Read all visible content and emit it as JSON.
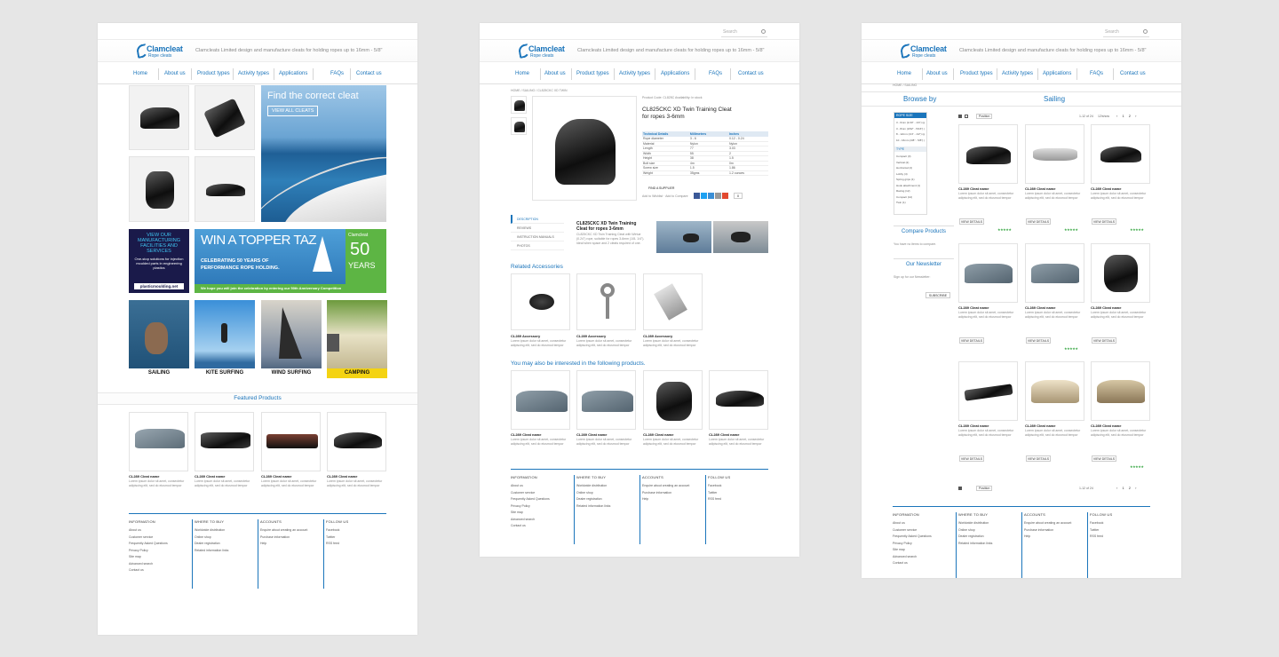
{
  "brand": {
    "logo": "Clamcleat",
    "logo_sub": "Rope cleats",
    "tagline": "Clamcleats Limited design and manufacture cleats for holding ropes up to 16mm - 5/8\""
  },
  "search": {
    "placeholder": "Search"
  },
  "nav": [
    "Home",
    "About us",
    "Product types",
    "Activity types",
    "Applications",
    "FAQs",
    "Contact us"
  ],
  "home": {
    "hero_title": "Find the correct cleat",
    "hero_button": "VIEW ALL CLEATS",
    "promo_lines": [
      "VIEW OUR",
      "MANUFACTURING",
      "FACILITIES AND",
      "SERVICES"
    ],
    "promo_sub": "One-stop solutions for injection moulded parts in engineering plastics",
    "promo_url": "plasticmoulding.net",
    "banner_title": "WIN A TOPPER TAZ",
    "banner_sub1": "CELEBRATING 50 YEARS OF",
    "banner_sub2": "PERFORMANCE ROPE HOLDING.",
    "banner_brand": "Clamcleat",
    "banner_years_num": "50",
    "banner_years": "YEARS",
    "banner_footer": "We hope you will join the celebration by entering our 50th Anniversary Competition",
    "activities": [
      "SAILING",
      "KITE SURFING",
      "WIND SURFING",
      "CAMPING"
    ],
    "featured_title": "Featured Products"
  },
  "products": {
    "name": "CL289 Cleat name",
    "desc": "Lorem ipsum dolor sit amet, consectetur adipiscing elit, sed do eiusmod tempor",
    "accessory_name": "CL289 Accessory"
  },
  "product_page": {
    "breadcrumb": "HOME / SAILING / CL825CKC XD TWIN",
    "meta": "Product Code: CL825C   Availability: In stock",
    "title_line1": "CL825CKC XD Twin Training Cleat",
    "title_line2": "for ropes 3-6mm",
    "table_headers": [
      "Technical Details",
      "Millimetres",
      "Inches"
    ],
    "table_rows": [
      [
        "Rope diameter",
        "3 - 6",
        "0.12 - 0.24"
      ],
      [
        "Material",
        "Nylon",
        "Nylon"
      ],
      [
        "Length",
        "77",
        "3.03"
      ],
      [
        "Width",
        "55",
        "2"
      ],
      [
        "Height",
        "38",
        "1.5"
      ],
      [
        "Bolt size",
        "4m",
        "0m"
      ],
      [
        "Screw size",
        "1.5",
        "1.86"
      ],
      [
        "Weight",
        "35gms",
        "1.2 ounces"
      ]
    ],
    "find_supplier": "FIND A SUPPLIER",
    "wishlist": "Add to Wishlist  ·  Add to Compare",
    "share_count": "0",
    "tabs": [
      "DESCRIPTION",
      "REVIEWS",
      "INSTRUCTION MANUALS",
      "PHOTOS"
    ],
    "desc_title": "CL825CKC XD Twin Training Cleat for ropes 3-6mm",
    "desc_text": "CL825CKC XD Twin Training Cleat with Wirtue (0.24\") rope, suitable for ropes 3-6mm (1/8- 1/4\"). Ideal when space and 2 cleats required of one.",
    "related_title": "Related Accessories",
    "interest_title": "You may also be interested in the following products."
  },
  "listing": {
    "breadcrumb": "HOME / SAILING",
    "browse_by": "Browse by",
    "category": "Sailing",
    "filter_rope": "ROPE SIZE",
    "rope_sizes": [
      "3 - 6mm (1/10\" - 1/4\") (qty: 1)",
      "3 - 8mm (3/32\" - 5/16\") (qty: 1)",
      "8 - 12mm (1/4\" - 1/2\") (qty: 1)",
      "10 - 16mm (3/8\" - 5/8\") (qty: 1)"
    ],
    "filter_type": "TYPE",
    "types": [
      "Compact (3)",
      "Vertical (2)",
      "Horizontal (4)",
      "Lobby (4)",
      "Spring grips (1)",
      "Hook attachment (1)",
      "Racing (12)",
      "Compact (12)",
      "Twin (1)"
    ],
    "compare_title": "Compare Products",
    "compare_text": "You have no items to compare.",
    "newsletter_title": "Our Newsletter",
    "newsletter_text": "Sign up for our Newsletter:",
    "subscribe": "SUBSCRIBE",
    "toolbar_position": "Position",
    "toolbar_count": "1-12 of 24",
    "toolbar_show": "12/show",
    "view_details": "VIEW DETAILS"
  },
  "footer": {
    "cols": [
      {
        "title": "INFORMATION",
        "links": [
          "About us",
          "Customer service",
          "Frequently Asked Questions",
          "Privacy Policy",
          "Site map",
          "Advanced search",
          "Contact us"
        ]
      },
      {
        "title": "WHERE TO BUY",
        "links": [
          "Worldwide distribution",
          "Online shop",
          "Dealer registration",
          "Related information links"
        ]
      },
      {
        "title": "ACCOUNTS",
        "links": [
          "Enquire about creating an account",
          "Purchase information",
          "Help"
        ]
      },
      {
        "title": "FOLLOW US",
        "links": [
          "Facebook",
          "Twitter",
          "RSS feed"
        ]
      }
    ]
  },
  "colors": {
    "accent": "#1b75bb",
    "green": "#6bbd3e",
    "sea": "#2f7fb8"
  }
}
